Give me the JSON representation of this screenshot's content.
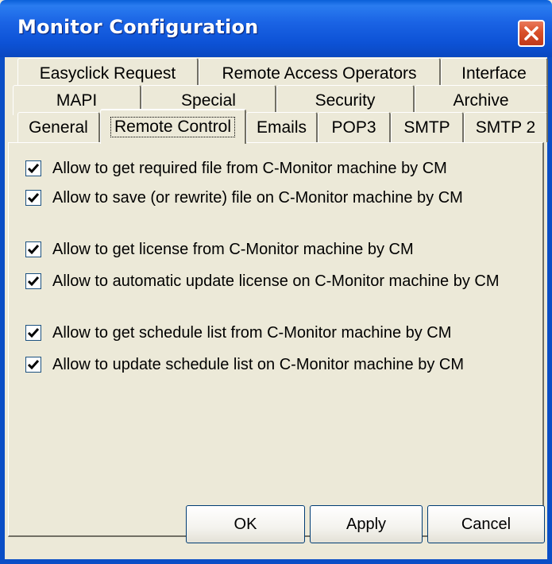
{
  "window": {
    "title": "Monitor Configuration"
  },
  "tabs": {
    "row1": [
      "Easyclick Request",
      "Remote Access Operators",
      "Interface"
    ],
    "row2": [
      "MAPI",
      "Special",
      "Security",
      "Archive"
    ],
    "row3": [
      "General",
      "Remote Control",
      "Emails",
      "POP3",
      "SMTP",
      "SMTP 2"
    ],
    "active": "Remote Control"
  },
  "options": [
    {
      "label": "Allow to get required file from C-Monitor machine by CM",
      "checked": true
    },
    {
      "label": "Allow to save (or rewrite) file on C-Monitor machine by CM",
      "checked": true
    },
    {
      "label": "Allow to get license from C-Monitor machine by CM",
      "checked": true
    },
    {
      "label": "Allow to automatic update license on C-Monitor machine by CM",
      "checked": true
    },
    {
      "label": "Allow to get schedule list from C-Monitor machine by CM",
      "checked": true
    },
    {
      "label": "Allow to update schedule list on C-Monitor machine by CM",
      "checked": true
    }
  ],
  "buttons": {
    "ok": "OK",
    "apply": "Apply",
    "cancel": "Cancel"
  },
  "colors": {
    "title_bar": "#0a5fd8",
    "window_face": "#ece9d8",
    "close_button": "#d9502a",
    "checkmark": "#21a121"
  },
  "icons": {
    "close": "close-icon",
    "check": "checkmark-icon"
  }
}
